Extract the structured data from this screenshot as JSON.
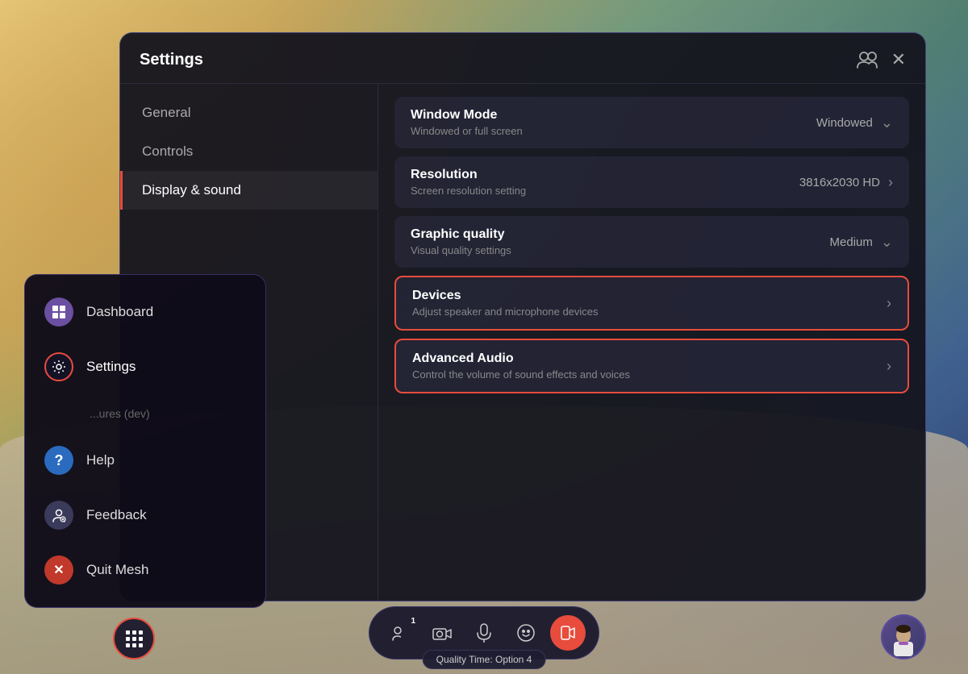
{
  "background": {
    "description": "VR outdoor scene with mountains and terrain"
  },
  "settings_panel": {
    "title": "Settings",
    "sidebar_items": [
      {
        "id": "general",
        "label": "General",
        "active": false
      },
      {
        "id": "controls",
        "label": "Controls",
        "active": false
      },
      {
        "id": "display-sound",
        "label": "Display & sound",
        "active": true
      }
    ],
    "content_rows": [
      {
        "id": "window-mode",
        "title": "Window Mode",
        "subtitle": "Windowed or full screen",
        "value": "Windowed",
        "type": "dropdown",
        "highlighted": false
      },
      {
        "id": "resolution",
        "title": "Resolution",
        "subtitle": "Screen resolution setting",
        "value": "3816x2030 HD",
        "type": "arrow",
        "highlighted": false
      },
      {
        "id": "graphic-quality",
        "title": "Graphic quality",
        "subtitle": "Visual quality settings",
        "value": "Medium",
        "type": "dropdown",
        "highlighted": false
      },
      {
        "id": "devices",
        "title": "Devices",
        "subtitle": "Adjust speaker and microphone devices",
        "value": "",
        "type": "arrow",
        "highlighted": true
      },
      {
        "id": "advanced-audio",
        "title": "Advanced Audio",
        "subtitle": "Control the volume of sound effects and voices",
        "value": "",
        "type": "arrow",
        "highlighted": true
      }
    ]
  },
  "side_menu": {
    "items": [
      {
        "id": "dashboard",
        "label": "Dashboard",
        "icon": "⊞",
        "icon_type": "purple"
      },
      {
        "id": "settings",
        "label": "Settings",
        "icon": "⚙",
        "icon_type": "highlighted-red",
        "active": true
      },
      {
        "id": "features-dev",
        "label": "...ures (dev)",
        "icon": "",
        "icon_type": "none",
        "hidden": true
      },
      {
        "id": "help",
        "label": "Help",
        "icon": "?",
        "icon_type": "blue"
      },
      {
        "id": "feedback",
        "label": "Feedback",
        "icon": "👤",
        "icon_type": "gray"
      },
      {
        "id": "quit-mesh",
        "label": "Quit Mesh",
        "icon": "✕",
        "icon_type": "red"
      }
    ]
  },
  "taskbar": {
    "buttons": [
      {
        "id": "people",
        "icon": "👤",
        "badge": "1",
        "active": false
      },
      {
        "id": "camera",
        "icon": "📷",
        "badge": "",
        "active": false
      },
      {
        "id": "mic",
        "icon": "🎤",
        "badge": "",
        "active": false
      },
      {
        "id": "emoji",
        "icon": "😊",
        "badge": "",
        "active": false
      },
      {
        "id": "record",
        "icon": "⏺",
        "badge": "",
        "active": true
      }
    ],
    "apps_button": "apps",
    "quality_badge": "Quality Time: Option 4"
  },
  "icons": {
    "close": "✕",
    "user_group": "👥",
    "chevron_down": "⌄",
    "chevron_right": "›"
  }
}
